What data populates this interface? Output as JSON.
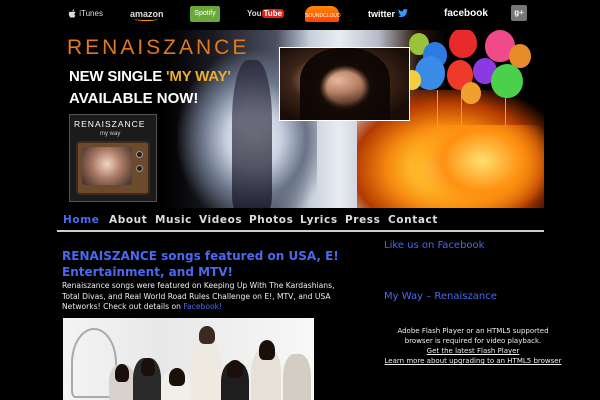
{
  "social": {
    "itunes": "iTunes",
    "amazon": "amazon",
    "spotify": "Spotify",
    "youtube_you": "You",
    "youtube_tube": "Tube",
    "soundcloud": "SOUNDCLOUD",
    "twitter": "twitter",
    "facebook": "facebook",
    "gplus": "g+"
  },
  "banner": {
    "brand": "RENAISZANCE",
    "line1_prefix": "NEW SINGLE",
    "line1_accent": "'MY WAY'",
    "line2": "AVAILABLE NOW!",
    "tv_brand": "RENAISZANCE",
    "tv_subtitle": "my way"
  },
  "nav": {
    "items": [
      "Home",
      "About",
      "Music",
      "Videos",
      "Photos",
      "Lyrics",
      "Press",
      "Contact"
    ],
    "active": "Home"
  },
  "post": {
    "title": "RENAISZANCE songs featured on USA, E! Entertainment, and MTV!",
    "body": "Renaiszance songs were featured on Keeping Up With The Kardashians, Total Divas, and Real World Road Rules Challenge on E!, MTV, and USA Networks! Check out details on",
    "link": "Facebook!"
  },
  "sidebar": {
    "facebook_heading": "Like us on Facebook",
    "video_heading": "My Way – Renaiszance",
    "flash_line1": "Adobe Flash Player or an HTML5 supported browser is required for video playback.",
    "flash_link1": "Get the latest Flash Player",
    "flash_link2": "Learn more about upgrading to an HTML5 browser"
  },
  "colors": {
    "accent_blue": "#4a68f0",
    "brand_orange": "#e07a1c",
    "background": "#000000"
  }
}
